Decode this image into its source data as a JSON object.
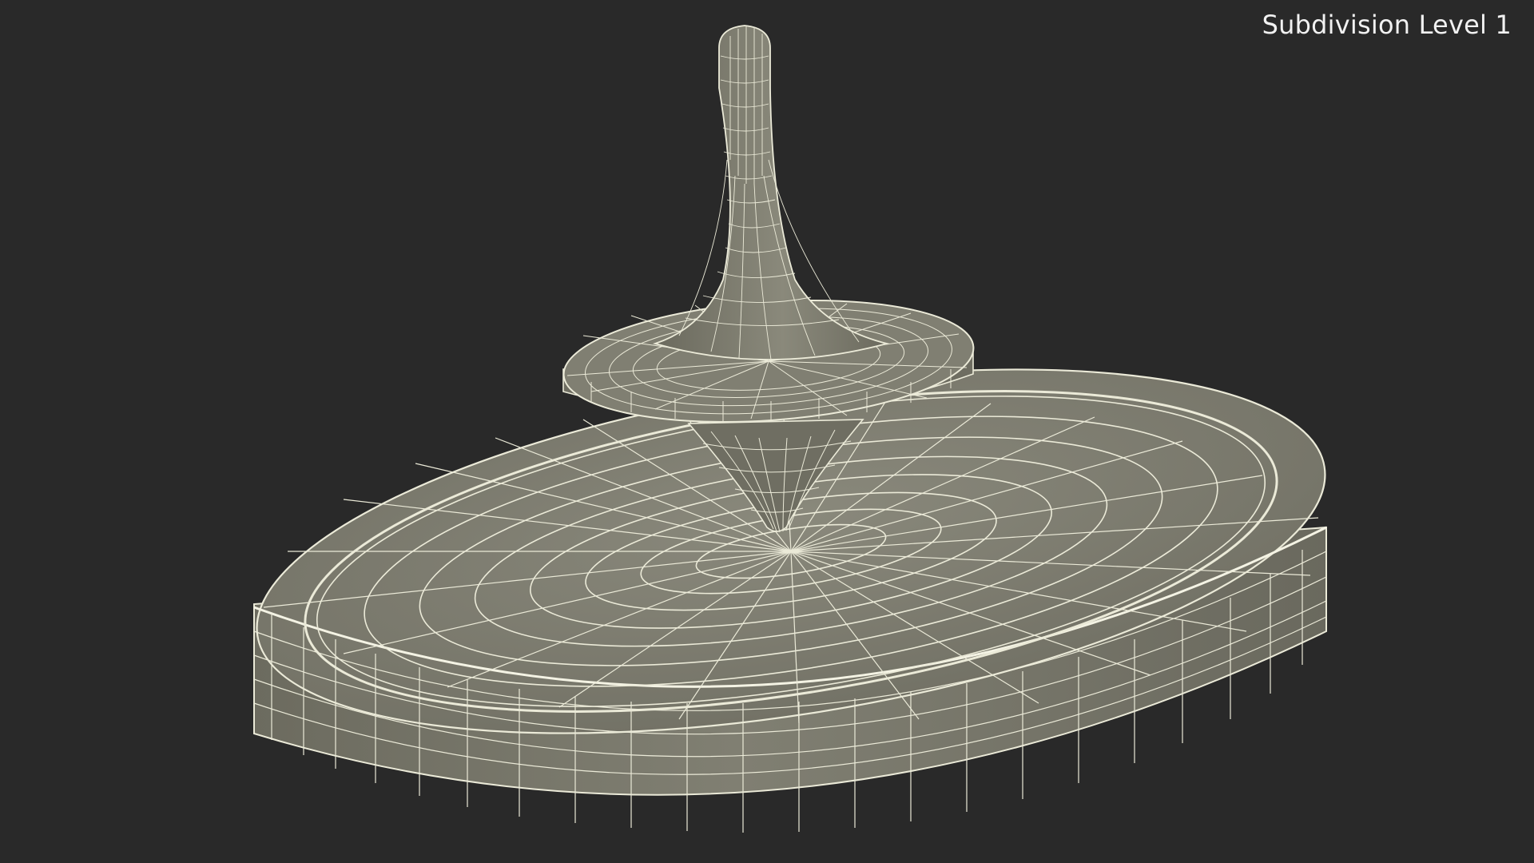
{
  "viewport": {
    "label": "Subdivision Level 1",
    "background_color": "#292929"
  },
  "model": {
    "surface_color": "#7b7a6d",
    "wire_color": "#ebead8",
    "shadow_color": "#5f5e53"
  }
}
